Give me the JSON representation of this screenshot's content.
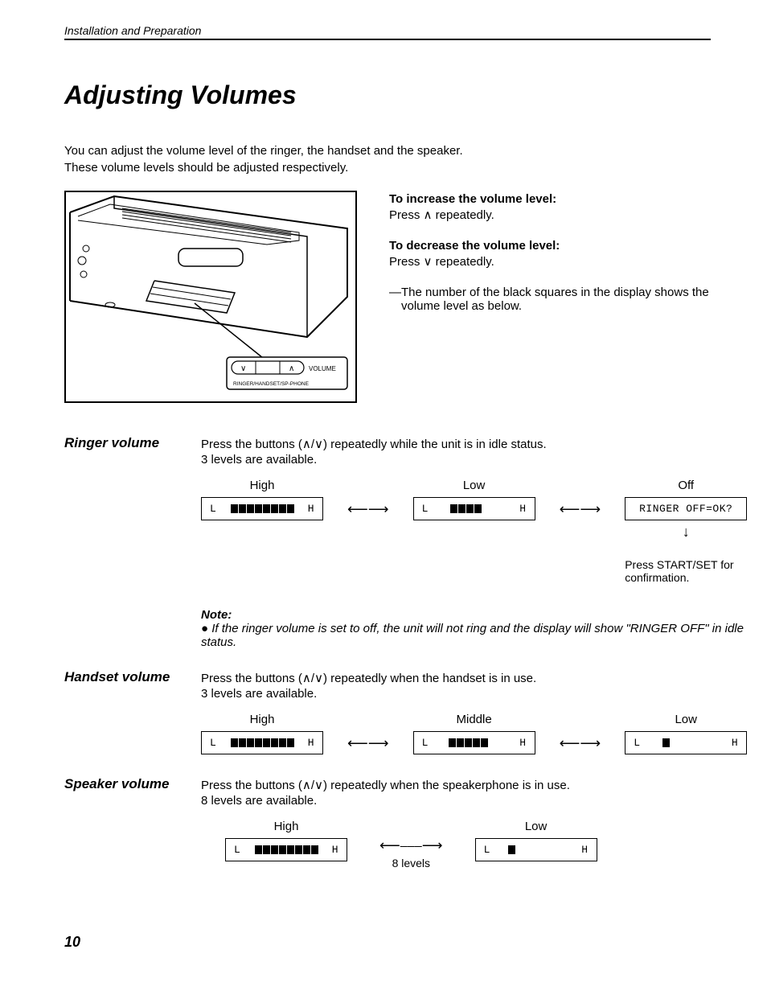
{
  "header": "Installation and Preparation",
  "title": "Adjusting Volumes",
  "intro1": "You can adjust the volume level of the ringer, the handset and the speaker.",
  "intro2": "These volume levels should be adjusted respectively.",
  "device": {
    "btn_label": "VOLUME",
    "sub_label": "RINGER/HANDSET/SP-PHONE"
  },
  "right": {
    "inc_title": "To increase the volume level:",
    "inc_body": "Press ∧ repeatedly.",
    "dec_title": "To decrease the volume level:",
    "dec_body": "Press ∨ repeatedly.",
    "squares": "—The number of the black squares in the display shows the volume level as below."
  },
  "ringer": {
    "label": "Ringer volume",
    "line1": "Press the buttons (∧/∨) repeatedly while the unit is in idle status.",
    "line2": "3 levels are available.",
    "high": "High",
    "low": "Low",
    "off": "Off",
    "off_text": "RINGER OFF=OK?",
    "confirm": "Press START/SET for confirmation.",
    "note_title": "Note:",
    "note_text": "● If the ringer volume is set to off, the unit will not ring and the display will show \"RINGER OFF\" in idle status."
  },
  "handset": {
    "label": "Handset volume",
    "line1": "Press the buttons (∧/∨) repeatedly when the handset is in use.",
    "line2": "3 levels are available.",
    "high": "High",
    "mid": "Middle",
    "low": "Low"
  },
  "speaker": {
    "label": "Speaker volume",
    "line1": "Press the buttons (∧/∨) repeatedly when the speakerphone is in use.",
    "line2": "8 levels are available.",
    "high": "High",
    "low": "Low",
    "eight": "8 levels"
  },
  "page": "10",
  "lcd": {
    "L": "L",
    "H": "H"
  }
}
